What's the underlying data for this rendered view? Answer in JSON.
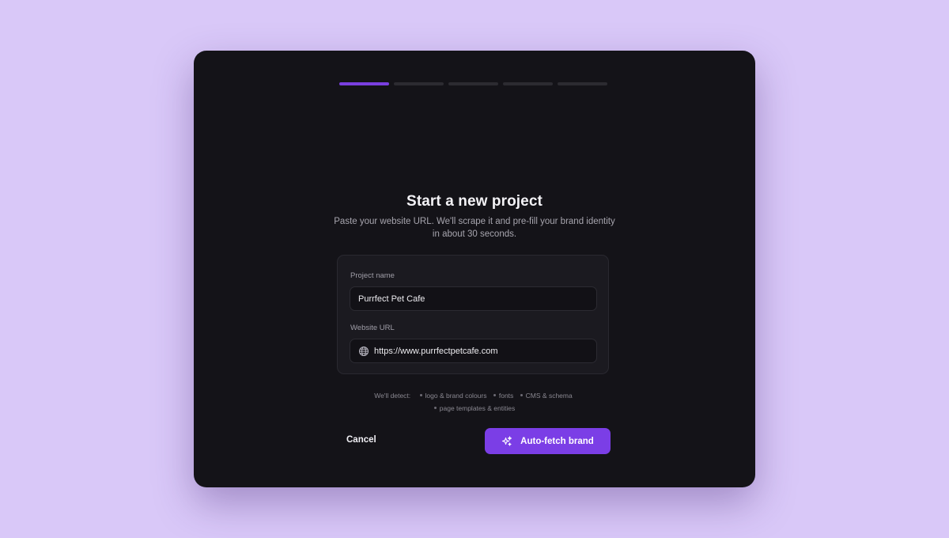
{
  "wizard": {
    "steps_total": 5,
    "current_step": 1
  },
  "header": {
    "title": "Start a new project",
    "subtitle": "Paste your website URL. We'll scrape it and pre-fill your brand identity in about 30 seconds."
  },
  "form": {
    "project_name_label": "Project name",
    "project_name_value": "Purrfect Pet Cafe",
    "website_url_label": "Website URL",
    "website_url_value": "https://www.purrfectpetcafe.com",
    "website_icon": "globe-icon"
  },
  "detect": {
    "lead": "We'll detect:",
    "items": [
      "logo & brand colours",
      "fonts",
      "CMS & schema",
      "page templates & entities"
    ]
  },
  "actions": {
    "cancel_label": "Cancel",
    "primary_label": "Auto-fetch brand",
    "primary_icon": "sparkle-icon"
  },
  "colors": {
    "page_bg": "#d9c8f8",
    "modal_bg": "#141318",
    "accent": "#7b3ee6",
    "progress_active": "#7a3fe0",
    "progress_inactive": "#2c2b31"
  }
}
